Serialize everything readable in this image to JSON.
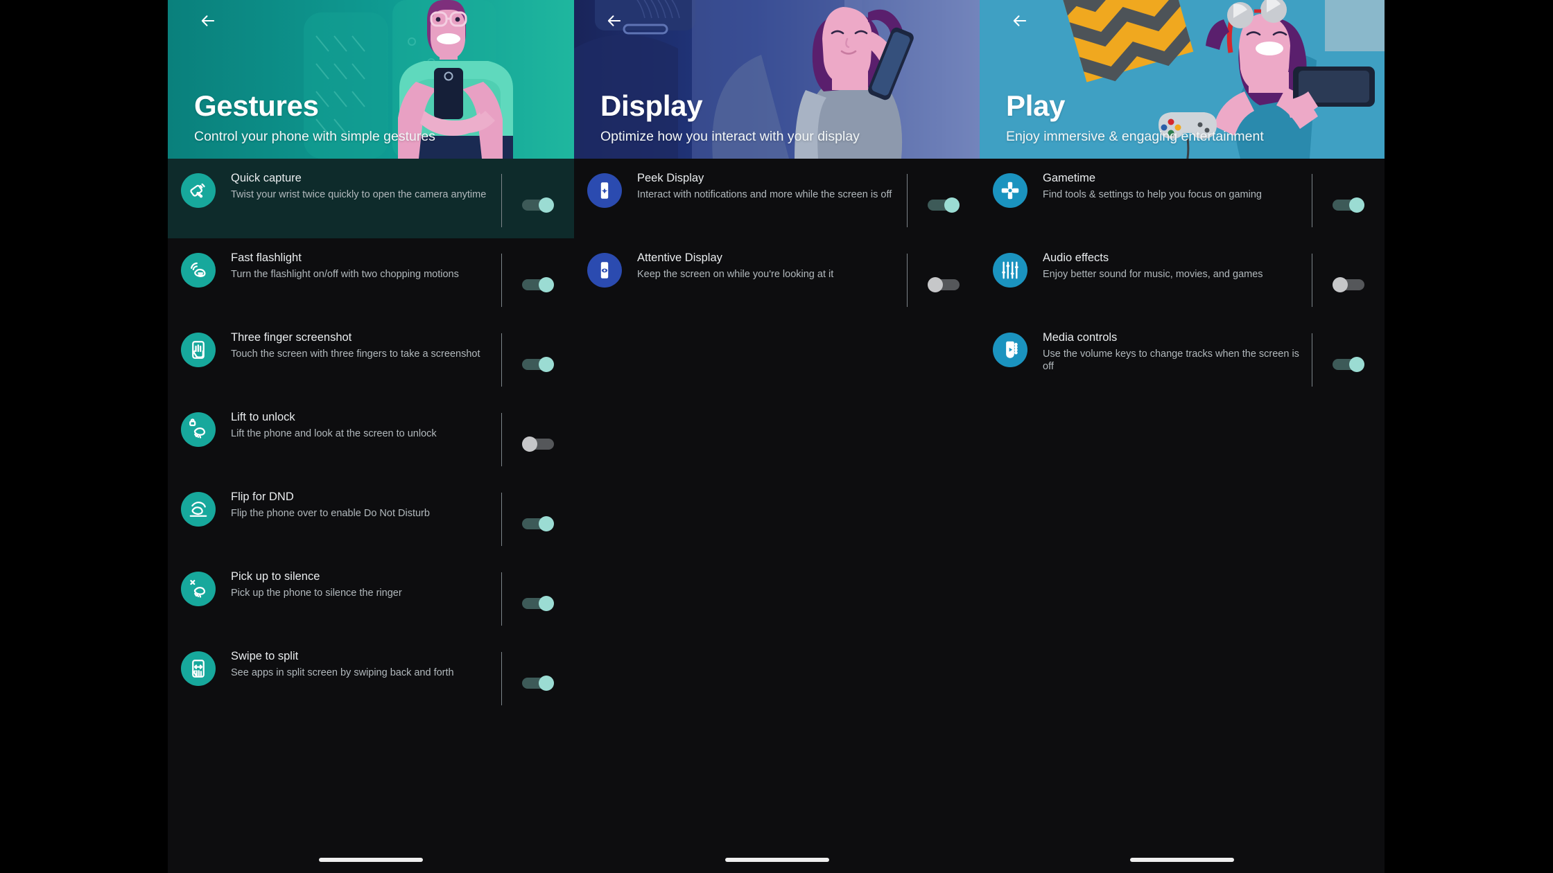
{
  "panels": [
    {
      "id": "gestures",
      "back_label": "Back",
      "title": "Gestures",
      "subtitle": "Control your phone with simple gestures",
      "theme": {
        "hero_bg": "#0b8f8a",
        "icon_bg": "#17a89c",
        "accent": "#17a89c"
      },
      "items": [
        {
          "icon": "twist-phone-icon",
          "title": "Quick capture",
          "desc": "Twist your wrist twice quickly to open the camera anytime",
          "toggle": "on",
          "selected": true
        },
        {
          "icon": "chop-flashlight-icon",
          "title": "Fast flashlight",
          "desc": "Turn the flashlight on/off with two chopping motions",
          "toggle": "on",
          "selected": false
        },
        {
          "icon": "three-finger-icon",
          "title": "Three finger screenshot",
          "desc": "Touch the screen with three fingers to take a screenshot",
          "toggle": "on",
          "selected": false
        },
        {
          "icon": "lift-unlock-icon",
          "title": "Lift to unlock",
          "desc": "Lift the phone and look at the screen to unlock",
          "toggle": "off",
          "selected": false
        },
        {
          "icon": "flip-dnd-icon",
          "title": "Flip for DND",
          "desc": "Flip the phone over to enable Do Not Disturb",
          "toggle": "on",
          "selected": false
        },
        {
          "icon": "pickup-silence-icon",
          "title": "Pick up to silence",
          "desc": "Pick up the phone to silence the ringer",
          "toggle": "on",
          "selected": false
        },
        {
          "icon": "swipe-split-icon",
          "title": "Swipe to split",
          "desc": "See apps in split screen by swiping back and forth",
          "toggle": "on",
          "selected": false
        }
      ]
    },
    {
      "id": "display",
      "back_label": "Back",
      "title": "Display",
      "subtitle": "Optimize how you interact with your display",
      "theme": {
        "hero_bg": "#1d2b6b",
        "icon_bg": "#2b4bb0",
        "accent": "#2b4bb0"
      },
      "items": [
        {
          "icon": "peek-display-icon",
          "title": "Peek Display",
          "desc": "Interact with notifications and more while the screen is off",
          "toggle": "on",
          "selected": false
        },
        {
          "icon": "attentive-display-icon",
          "title": "Attentive Display",
          "desc": "Keep the screen on while you're looking at it",
          "toggle": "off",
          "selected": false
        }
      ]
    },
    {
      "id": "play",
      "back_label": "Back",
      "title": "Play",
      "subtitle": "Enjoy immersive & engaging entertainment",
      "theme": {
        "hero_bg": "#3d9cbd",
        "icon_bg": "#1b93bf",
        "accent": "#1b93bf"
      },
      "items": [
        {
          "icon": "gamepad-dpad-icon",
          "title": "Gametime",
          "desc": "Find tools & settings to help you focus on gaming",
          "toggle": "on",
          "selected": false
        },
        {
          "icon": "equalizer-icon",
          "title": "Audio effects",
          "desc": "Enjoy better sound for music, movies, and games",
          "toggle": "off",
          "selected": false
        },
        {
          "icon": "media-controls-icon",
          "title": "Media controls",
          "desc": "Use the volume keys to change tracks when the screen is off",
          "toggle": "on",
          "selected": false
        }
      ]
    }
  ],
  "nav": {
    "pill_label": "home-gesture-pill"
  }
}
